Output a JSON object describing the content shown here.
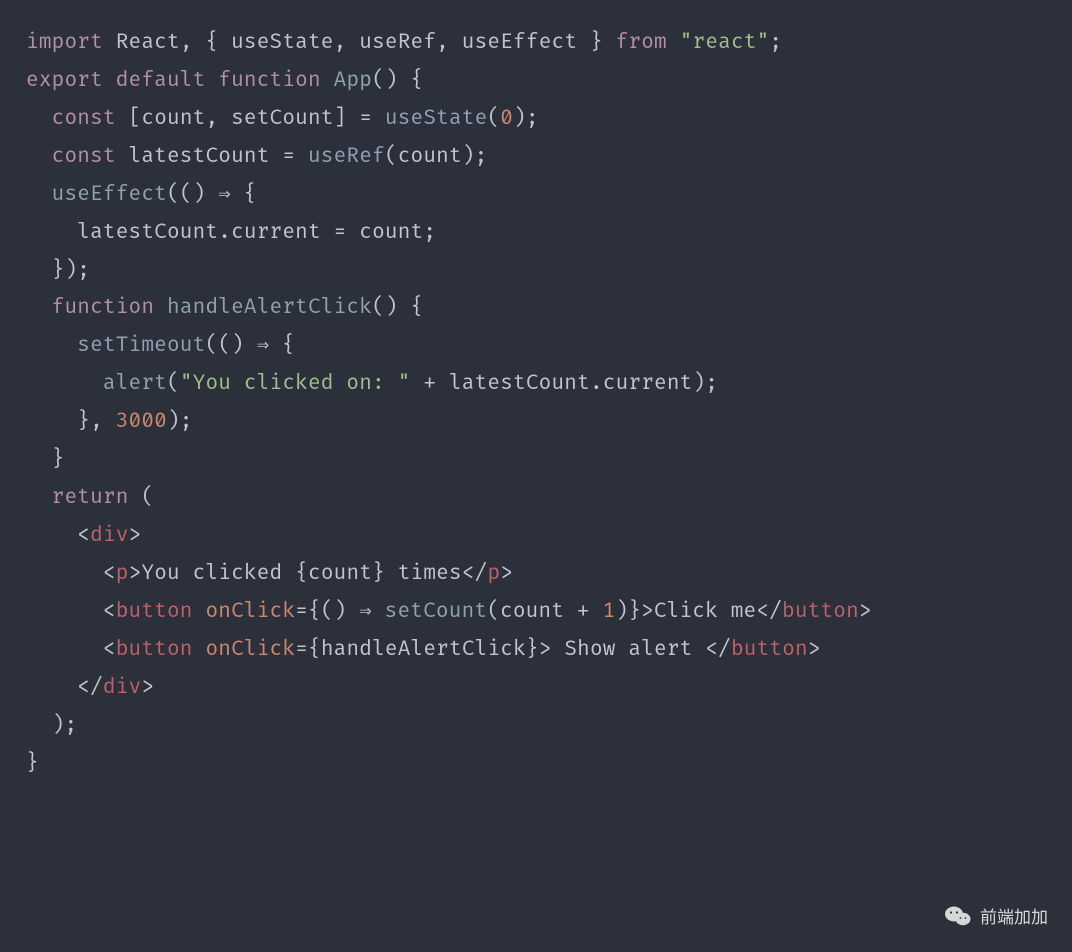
{
  "code": {
    "lines": [
      {
        "tokens": [
          [
            "kw",
            "import"
          ],
          [
            "sp",
            " "
          ],
          [
            "id",
            "React"
          ],
          [
            "op",
            ", { "
          ],
          [
            "id",
            "useState"
          ],
          [
            "op",
            ", "
          ],
          [
            "id",
            "useRef"
          ],
          [
            "op",
            ", "
          ],
          [
            "id",
            "useEffect"
          ],
          [
            "op",
            " } "
          ],
          [
            "kw",
            "from"
          ],
          [
            "sp",
            " "
          ],
          [
            "str",
            "\"react\""
          ],
          [
            "op",
            ";"
          ]
        ]
      },
      {
        "tokens": [
          [
            "sp",
            ""
          ]
        ]
      },
      {
        "tokens": [
          [
            "kw",
            "export"
          ],
          [
            "sp",
            " "
          ],
          [
            "kw",
            "default"
          ],
          [
            "sp",
            " "
          ],
          [
            "kw",
            "function"
          ],
          [
            "sp",
            " "
          ],
          [
            "fn",
            "App"
          ],
          [
            "op",
            "() {"
          ]
        ]
      },
      {
        "tokens": [
          [
            "sp",
            "  "
          ],
          [
            "kw",
            "const"
          ],
          [
            "sp",
            " "
          ],
          [
            "op",
            "["
          ],
          [
            "id",
            "count"
          ],
          [
            "op",
            ", "
          ],
          [
            "id",
            "setCount"
          ],
          [
            "op",
            "] = "
          ],
          [
            "fn",
            "useState"
          ],
          [
            "op",
            "("
          ],
          [
            "num",
            "0"
          ],
          [
            "op",
            ");"
          ]
        ]
      },
      {
        "tokens": [
          [
            "sp",
            "  "
          ],
          [
            "kw",
            "const"
          ],
          [
            "sp",
            " "
          ],
          [
            "id",
            "latestCount"
          ],
          [
            "op",
            " = "
          ],
          [
            "fn",
            "useRef"
          ],
          [
            "op",
            "("
          ],
          [
            "id",
            "count"
          ],
          [
            "op",
            ");"
          ]
        ]
      },
      {
        "tokens": [
          [
            "sp",
            ""
          ]
        ]
      },
      {
        "tokens": [
          [
            "sp",
            "  "
          ],
          [
            "fn",
            "useEffect"
          ],
          [
            "op",
            "(() "
          ],
          [
            "op",
            "⇒"
          ],
          [
            "op",
            " {"
          ]
        ]
      },
      {
        "tokens": [
          [
            "sp",
            "    "
          ],
          [
            "id",
            "latestCount"
          ],
          [
            "op",
            "."
          ],
          [
            "id",
            "current"
          ],
          [
            "op",
            " = "
          ],
          [
            "id",
            "count"
          ],
          [
            "op",
            ";"
          ]
        ]
      },
      {
        "tokens": [
          [
            "sp",
            "  "
          ],
          [
            "op",
            "});"
          ]
        ]
      },
      {
        "tokens": [
          [
            "sp",
            ""
          ]
        ]
      },
      {
        "tokens": [
          [
            "sp",
            "  "
          ],
          [
            "kw",
            "function"
          ],
          [
            "sp",
            " "
          ],
          [
            "fn",
            "handleAlertClick"
          ],
          [
            "op",
            "() {"
          ]
        ]
      },
      {
        "tokens": [
          [
            "sp",
            "    "
          ],
          [
            "fn",
            "setTimeout"
          ],
          [
            "op",
            "(() "
          ],
          [
            "op",
            "⇒"
          ],
          [
            "op",
            " {"
          ]
        ]
      },
      {
        "tokens": [
          [
            "sp",
            "      "
          ],
          [
            "fn",
            "alert"
          ],
          [
            "op",
            "("
          ],
          [
            "str",
            "\"You clicked on: \""
          ],
          [
            "op",
            " + "
          ],
          [
            "id",
            "latestCount"
          ],
          [
            "op",
            "."
          ],
          [
            "id",
            "current"
          ],
          [
            "op",
            ");"
          ]
        ]
      },
      {
        "tokens": [
          [
            "sp",
            "    "
          ],
          [
            "op",
            "}, "
          ],
          [
            "num",
            "3000"
          ],
          [
            "op",
            ");"
          ]
        ]
      },
      {
        "tokens": [
          [
            "sp",
            "  "
          ],
          [
            "op",
            "}"
          ]
        ]
      },
      {
        "tokens": [
          [
            "sp",
            ""
          ]
        ]
      },
      {
        "tokens": [
          [
            "sp",
            "  "
          ],
          [
            "kw",
            "return"
          ],
          [
            "sp",
            " "
          ],
          [
            "op",
            "("
          ]
        ]
      },
      {
        "tokens": [
          [
            "sp",
            "    "
          ],
          [
            "op",
            "<"
          ],
          [
            "jsx",
            "div"
          ],
          [
            "op",
            ">"
          ]
        ]
      },
      {
        "tokens": [
          [
            "sp",
            "      "
          ],
          [
            "op",
            "<"
          ],
          [
            "jsx",
            "p"
          ],
          [
            "op",
            ">"
          ],
          [
            "id",
            "You clicked "
          ],
          [
            "op",
            "{"
          ],
          [
            "id",
            "count"
          ],
          [
            "op",
            "}"
          ],
          [
            "id",
            " times"
          ],
          [
            "op",
            "</"
          ],
          [
            "jsx",
            "p"
          ],
          [
            "op",
            ">"
          ]
        ]
      },
      {
        "tokens": [
          [
            "sp",
            "      "
          ],
          [
            "op",
            "<"
          ],
          [
            "jsx",
            "button"
          ],
          [
            "sp",
            " "
          ],
          [
            "attr",
            "onClick"
          ],
          [
            "op",
            "="
          ],
          [
            "op",
            "{"
          ],
          [
            "op",
            "() "
          ],
          [
            "op",
            "⇒"
          ],
          [
            "op",
            " "
          ],
          [
            "fn",
            "setCount"
          ],
          [
            "op",
            "("
          ],
          [
            "id",
            "count"
          ],
          [
            "op",
            " + "
          ],
          [
            "num",
            "1"
          ],
          [
            "op",
            ")}>"
          ],
          [
            "id",
            "Click me"
          ],
          [
            "op",
            "</"
          ],
          [
            "jsx",
            "button"
          ],
          [
            "op",
            ">"
          ]
        ]
      },
      {
        "tokens": [
          [
            "sp",
            "      "
          ],
          [
            "op",
            "<"
          ],
          [
            "jsx",
            "button"
          ],
          [
            "sp",
            " "
          ],
          [
            "attr",
            "onClick"
          ],
          [
            "op",
            "="
          ],
          [
            "op",
            "{"
          ],
          [
            "id",
            "handleAlertClick"
          ],
          [
            "op",
            "}>"
          ],
          [
            "id",
            " Show alert "
          ],
          [
            "op",
            "</"
          ],
          [
            "jsx",
            "button"
          ],
          [
            "op",
            ">"
          ]
        ]
      },
      {
        "tokens": [
          [
            "sp",
            "    "
          ],
          [
            "op",
            "</"
          ],
          [
            "jsx",
            "div"
          ],
          [
            "op",
            ">"
          ]
        ]
      },
      {
        "tokens": [
          [
            "sp",
            "  "
          ],
          [
            "op",
            ");"
          ]
        ]
      },
      {
        "tokens": [
          [
            "op",
            "}"
          ]
        ]
      }
    ]
  },
  "watermark": {
    "text": "前端加加"
  }
}
